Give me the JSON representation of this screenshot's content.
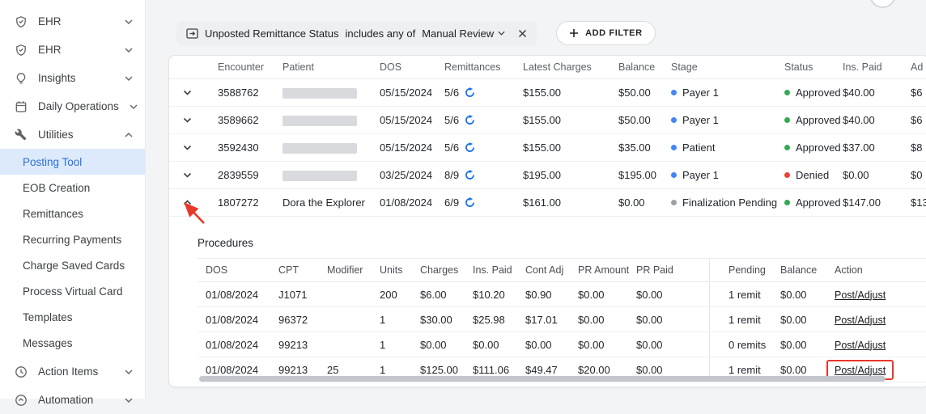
{
  "colors": {
    "accent_blue": "#2a6fd6",
    "selected_item_bg": "#ddeafb",
    "stage_blue": "#4285f4",
    "stage_gray": "#9aa0a6",
    "status_green": "#34a853",
    "status_red": "#ea4335",
    "sync_icon_blue": "#1a73e8",
    "annotation_red": "#e8382a"
  },
  "sidebar": {
    "items": [
      {
        "label": "EHR",
        "icon": "shield-icon"
      },
      {
        "label": "EHR",
        "icon": "shield-icon"
      },
      {
        "label": "Insights",
        "icon": "insights-icon"
      },
      {
        "label": "Daily Operations",
        "icon": "calendar-icon"
      },
      {
        "label": "Utilities",
        "icon": "wrench-icon"
      }
    ],
    "utilities_children": [
      {
        "label": "Posting Tool",
        "selected": true
      },
      {
        "label": "EOB Creation"
      },
      {
        "label": "Remittances"
      },
      {
        "label": "Recurring Payments"
      },
      {
        "label": "Charge Saved Cards"
      },
      {
        "label": "Process Virtual Card"
      },
      {
        "label": "Templates"
      },
      {
        "label": "Messages"
      }
    ],
    "footer_items": [
      {
        "label": "Action Items",
        "icon": "clock-icon"
      },
      {
        "label": "Automation",
        "icon": "automation-icon"
      }
    ]
  },
  "filter_bar": {
    "chip": {
      "field": "Unposted Remittance Status",
      "operator": "includes any of",
      "value": "Manual Review"
    },
    "add_filter_label": "ADD FILTER"
  },
  "encounter_table": {
    "columns": [
      "Encounter",
      "Patient",
      "DOS",
      "Remittances",
      "Latest Charges",
      "Balance",
      "Stage",
      "Status",
      "Ins. Paid",
      "Ad"
    ],
    "rows": [
      {
        "encounter": "3588762",
        "patient": "",
        "dos": "05/15/2024",
        "remittances": "5/6",
        "latest_charges": "$155.00",
        "balance": "$50.00",
        "stage": "Payer 1",
        "stage_color": "#4285f4",
        "status": "Approved",
        "status_color": "#34a853",
        "ins_paid": "$40.00",
        "adj": "$6",
        "expanded": false
      },
      {
        "encounter": "3589662",
        "patient": "",
        "dos": "05/15/2024",
        "remittances": "5/6",
        "latest_charges": "$155.00",
        "balance": "$50.00",
        "stage": "Payer 1",
        "stage_color": "#4285f4",
        "status": "Approved",
        "status_color": "#34a853",
        "ins_paid": "$40.00",
        "adj": "$6",
        "expanded": false
      },
      {
        "encounter": "3592430",
        "patient": "",
        "dos": "05/15/2024",
        "remittances": "5/6",
        "latest_charges": "$155.00",
        "balance": "$35.00",
        "stage": "Patient",
        "stage_color": "#4285f4",
        "status": "Approved",
        "status_color": "#34a853",
        "ins_paid": "$37.00",
        "adj": "$8",
        "expanded": false
      },
      {
        "encounter": "2839559",
        "patient": "",
        "dos": "03/25/2024",
        "remittances": "8/9",
        "latest_charges": "$195.00",
        "balance": "$195.00",
        "stage": "Payer 1",
        "stage_color": "#4285f4",
        "status": "Denied",
        "status_color": "#ea4335",
        "ins_paid": "$0.00",
        "adj": "$0",
        "expanded": false
      },
      {
        "encounter": "1807272",
        "patient": "Dora the Explorer",
        "dos": "01/08/2024",
        "remittances": "6/9",
        "latest_charges": "$161.00",
        "balance": "$0.00",
        "stage": "Finalization Pending",
        "stage_color": "#9aa0a6",
        "status": "Approved",
        "status_color": "#34a853",
        "ins_paid": "$147.00",
        "adj": "$13",
        "expanded": true
      }
    ]
  },
  "procedures": {
    "title": "Procedures",
    "columns": [
      "DOS",
      "CPT",
      "Modifier",
      "Units",
      "Charges",
      "Ins. Paid",
      "Cont Adj",
      "PR Amount",
      "PR Paid",
      "Pending",
      "Balance",
      "Action"
    ],
    "rows": [
      {
        "dos": "01/08/2024",
        "cpt": "J1071",
        "modifier": "",
        "units": "200",
        "charges": "$6.00",
        "ins_paid": "$10.20",
        "cont_adj": "$0.90",
        "pr_amount": "$0.00",
        "pr_paid": "$0.00",
        "pending": "1 remit",
        "balance": "$0.00",
        "action": "Post/Adjust",
        "highlighted": false
      },
      {
        "dos": "01/08/2024",
        "cpt": "96372",
        "modifier": "",
        "units": "1",
        "charges": "$30.00",
        "ins_paid": "$25.98",
        "cont_adj": "$17.01",
        "pr_amount": "$0.00",
        "pr_paid": "$0.00",
        "pending": "1 remit",
        "balance": "$0.00",
        "action": "Post/Adjust",
        "highlighted": false
      },
      {
        "dos": "01/08/2024",
        "cpt": "99213",
        "modifier": "",
        "units": "1",
        "charges": "$0.00",
        "ins_paid": "$0.00",
        "cont_adj": "$0.00",
        "pr_amount": "$0.00",
        "pr_paid": "$0.00",
        "pending": "0 remits",
        "balance": "$0.00",
        "action": "Post/Adjust",
        "highlighted": false
      },
      {
        "dos": "01/08/2024",
        "cpt": "99213",
        "modifier": "25",
        "units": "1",
        "charges": "$125.00",
        "ins_paid": "$111.06",
        "cont_adj": "$49.47",
        "pr_amount": "$20.00",
        "pr_paid": "$0.00",
        "pending": "1 remit",
        "balance": "$0.00",
        "action": "Post/Adjust",
        "highlighted": true
      }
    ]
  }
}
